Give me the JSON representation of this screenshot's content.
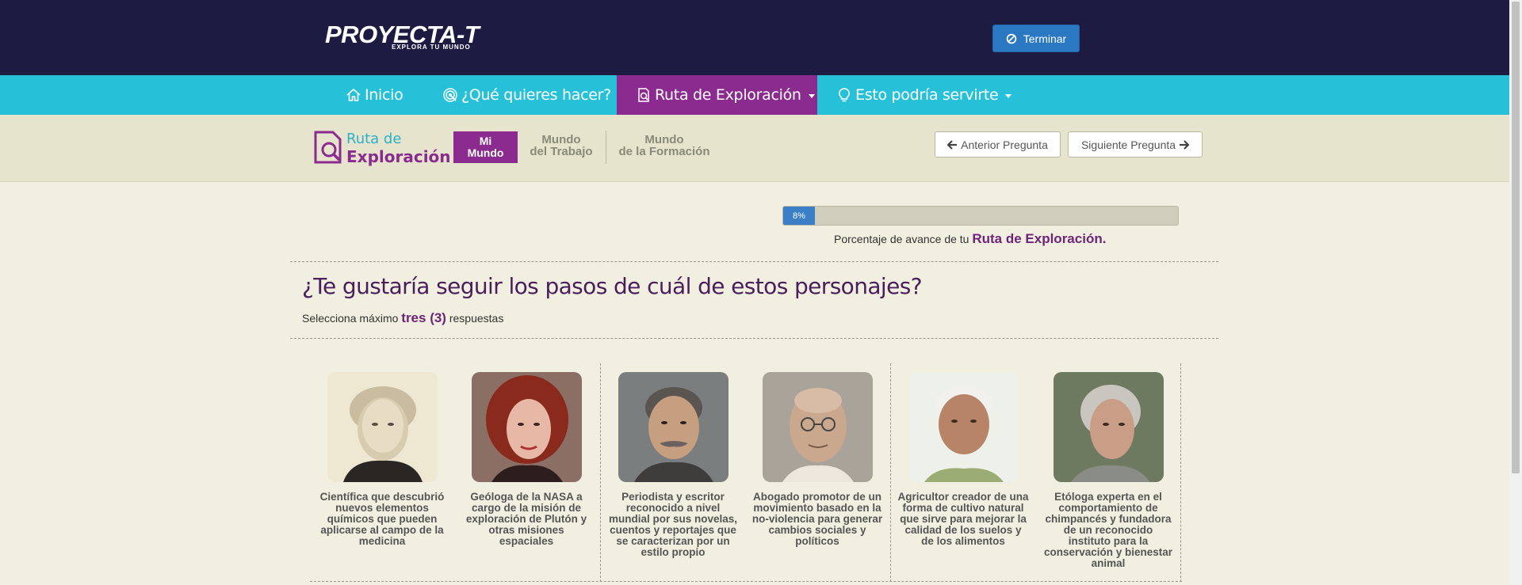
{
  "header": {
    "logo_text": "PROYECTA-T",
    "logo_tagline": "EXPLORA TU MUNDO",
    "terminar_label": "Terminar"
  },
  "nav": {
    "items": [
      {
        "label": "Inicio",
        "icon": "home-icon"
      },
      {
        "label": "¿Qué quieres hacer?",
        "icon": "target-icon"
      },
      {
        "label": "Ruta de Exploración",
        "icon": "search-doc-icon",
        "active": true
      },
      {
        "label": "Esto podría servirte",
        "icon": "lightbulb-icon"
      }
    ]
  },
  "subnav": {
    "title_line1": "Ruta de",
    "title_line2": "Exploración",
    "tabs": [
      {
        "line1": "Mi",
        "line2": "Mundo",
        "active": true
      },
      {
        "line1": "Mundo",
        "line2": "del Trabajo"
      },
      {
        "line1": "Mundo",
        "line2": "de la Formación"
      }
    ],
    "prev_label": "Anterior Pregunta",
    "next_label": "Siguiente Pregunta"
  },
  "progress": {
    "percent": 8,
    "label": "8%",
    "caption": "Porcentaje de avance de tu ",
    "caption_highlight": "Ruta de Exploración."
  },
  "question": {
    "title": "¿Te gustaría seguir los pasos de cuál de estos personajes?",
    "instruction_prefix": "Selecciona máximo ",
    "instruction_highlight": "tres (3)",
    "instruction_suffix": " respuestas"
  },
  "cards": [
    {
      "description": "Científica que descubrió nuevos elementos químicos que pueden aplicarse al campo de la medicina"
    },
    {
      "description": "Geóloga de la NASA a cargo de la misión de exploración de Plutón y otras misiones espaciales"
    },
    {
      "description": "Periodista y escritor reconocido a nivel mundial por sus novelas, cuentos y reportajes que se caracterizan por un estilo propio"
    },
    {
      "description": "Abogado promotor de un movimiento basado en la no-violencia para generar cambios sociales y políticos"
    },
    {
      "description": "Agricultor creador de una forma de cultivo natural que sirve para mejorar la calidad de los suelos y de los alimentos"
    },
    {
      "description": "Etóloga experta en el comportamiento de chimpancés y fundadora de un reconocido instituto para la conservación y bienestar animal"
    }
  ],
  "colors": {
    "header_bg": "#1d1b42",
    "nav_bg": "#27c0d9",
    "accent_purple": "#8c2b8f",
    "button_blue": "#2b78c2",
    "page_bg": "#f0efe0"
  }
}
